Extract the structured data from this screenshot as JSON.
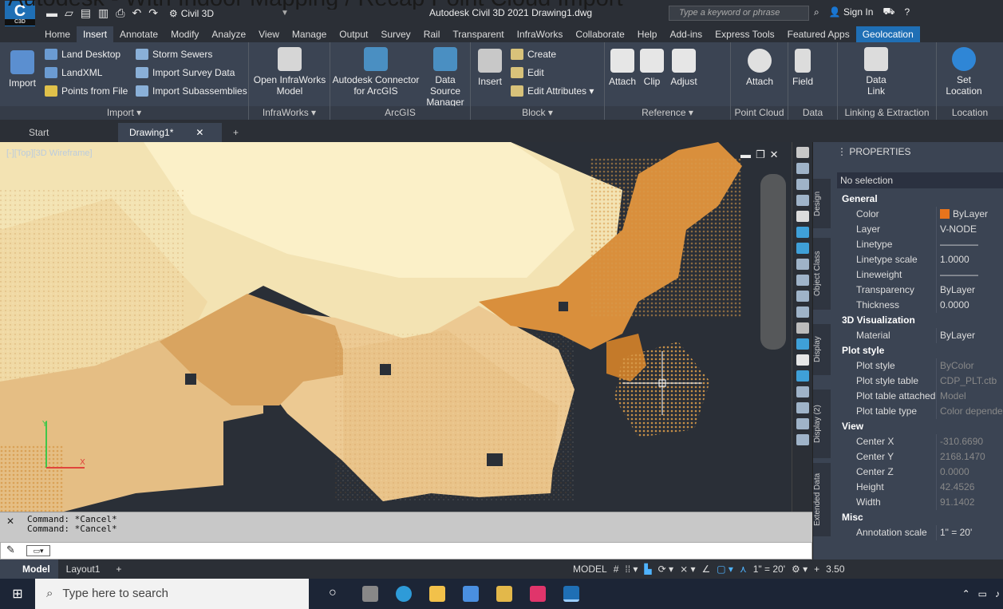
{
  "caption": {
    "text": "Autodesk - With Indoor Mapping / Recap Point Cloud Import"
  },
  "titlebar": {
    "logo": "C",
    "logo_small": "C3D",
    "workspace": "Civil 3D",
    "title": "Autodesk Civil 3D 2021   Drawing1.dwg",
    "search_placeholder": "Type a keyword or phrase",
    "sign_in": "Sign In"
  },
  "menu_tabs": [
    "Home",
    "Insert",
    "Annotate",
    "Modify",
    "Analyze",
    "View",
    "Manage",
    "Output",
    "Survey",
    "Rail",
    "Transparent",
    "InfraWorks",
    "Collaborate",
    "Help",
    "Add-ins",
    "Express Tools",
    "Featured Apps",
    "Geolocation"
  ],
  "ribbon": {
    "import": {
      "title": "Import ▾",
      "big": "Import",
      "items": [
        "Land Desktop",
        "LandXML",
        "Points from File",
        "Storm Sewers",
        "Import Survey Data",
        "Import Subassemblies"
      ]
    },
    "infraworks": {
      "title": "InfraWorks ▾",
      "big": "Open InfraWorks\nModel"
    },
    "arcgis": {
      "title": "ArcGIS",
      "big1": "Autodesk Connector\nfor ArcGIS",
      "big2": "Data Source\nManager"
    },
    "block": {
      "title": "Block ▾",
      "big": "Insert",
      "items": [
        "Create",
        "Edit",
        "Edit Attributes ▾"
      ]
    },
    "reference": {
      "title": "Reference ▾",
      "items": [
        "Attach",
        "Clip",
        "Adjust"
      ]
    },
    "pointcloud": {
      "title": "Point Cloud",
      "big": "Attach"
    },
    "data": {
      "title": "Data",
      "big": "Field"
    },
    "linking": {
      "title": "Linking & Extraction",
      "big": "Data\nLink"
    },
    "location": {
      "title": "Location",
      "big": "Set\nLocation"
    }
  },
  "doc_tabs": {
    "start": "Start",
    "drawing": "Drawing1*"
  },
  "viewport": {
    "label": "[-][Top][3D Wireframe]"
  },
  "properties": {
    "header": "PROPERTIES",
    "selection": "No selection",
    "vtabs": [
      "Design",
      "Object Class",
      "Display",
      "Display (2)",
      "Extended Data"
    ],
    "sections": [
      {
        "name": "General",
        "rows": [
          [
            "Color",
            "ByLayer"
          ],
          [
            "Layer",
            "V-NODE"
          ],
          [
            "Linetype",
            "————"
          ],
          [
            "Linetype scale",
            "1.0000"
          ],
          [
            "Lineweight",
            "————"
          ],
          [
            "Transparency",
            "ByLayer"
          ],
          [
            "Thickness",
            "0.0000"
          ]
        ]
      },
      {
        "name": "3D Visualization",
        "rows": [
          [
            "Material",
            "ByLayer"
          ]
        ]
      },
      {
        "name": "Plot style",
        "rows": [
          [
            "Plot style",
            "ByColor"
          ],
          [
            "Plot style table",
            "CDP_PLT.ctb"
          ],
          [
            "Plot table attached...",
            "Model"
          ],
          [
            "Plot table type",
            "Color dependent"
          ]
        ]
      },
      {
        "name": "View",
        "rows": [
          [
            "Center X",
            "-310.6690"
          ],
          [
            "Center Y",
            "2168.1470"
          ],
          [
            "Center Z",
            "0.0000"
          ],
          [
            "Height",
            "42.4526"
          ],
          [
            "Width",
            "91.1402"
          ]
        ]
      },
      {
        "name": "Misc",
        "rows": [
          [
            "Annotation scale",
            "1\" = 20'"
          ]
        ]
      }
    ],
    "color_swatch": "#e8741c"
  },
  "command": {
    "history": [
      "Command: *Cancel*",
      "Command: *Cancel*"
    ]
  },
  "status": {
    "model": "Model",
    "layout": "Layout1",
    "model_space": "MODEL",
    "scale": "1\" = 20'",
    "zoom": "3.50"
  },
  "taskbar": {
    "search": "Type here to search"
  },
  "colors": {
    "dark": "#2b2f36",
    "ribbon": "#3b4453",
    "accent": "#1f6fb5",
    "cloud_light": "#f3e3b3",
    "cloud_mid": "#e5be84",
    "cloud_dark": "#c97a2c"
  }
}
